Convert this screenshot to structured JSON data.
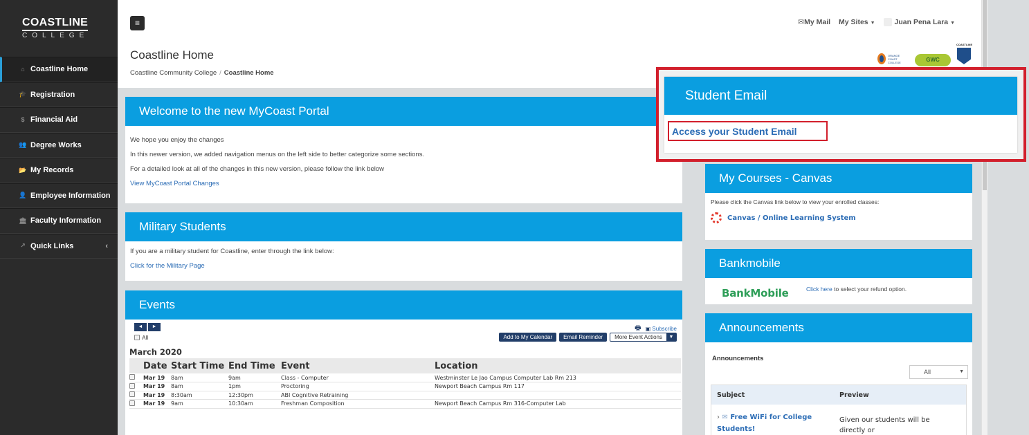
{
  "brand": {
    "line1": "COASTLINE",
    "line2": "COLLEGE"
  },
  "sidebar": {
    "items": [
      {
        "label": "Coastline Home",
        "icon": "home-icon",
        "glyph": "⌂",
        "active": true
      },
      {
        "label": "Registration",
        "icon": "graduation-cap-icon",
        "glyph": "🎓"
      },
      {
        "label": "Financial Aid",
        "icon": "money-icon",
        "glyph": "$"
      },
      {
        "label": "Degree Works",
        "icon": "users-icon",
        "glyph": "👥"
      },
      {
        "label": "My Records",
        "icon": "folder-icon",
        "glyph": "📂"
      },
      {
        "label": "Employee Information",
        "icon": "user-icon",
        "glyph": "👤"
      },
      {
        "label": "Faculty Information",
        "icon": "bank-icon",
        "glyph": "🏛"
      },
      {
        "label": "Quick Links",
        "icon": "external-link-icon",
        "glyph": "↗",
        "chevron": "‹"
      }
    ]
  },
  "header": {
    "menu_glyph": "≡",
    "title": "Coastline Home",
    "breadcrumb": {
      "root": "Coastline Community College",
      "sep": "/",
      "current": "Coastline Home"
    },
    "topnav": {
      "mail": "My Mail",
      "sites": "My Sites",
      "user": "Juan Pena Lara"
    },
    "logos": {
      "occ": "ORANGE COAST COLLEGE",
      "gwc": "GWC",
      "cc": "COASTLINE"
    }
  },
  "welcome": {
    "title": "Welcome to the new MyCoast Portal",
    "lines": [
      "We hope you enjoy the changes",
      "In this newer version, we added navigation menus on the left side to better categorize some sections.",
      "For a detailed look at all of the changes in this new version, please follow the link below"
    ],
    "link": "View MyCoast Portal Changes"
  },
  "military": {
    "title": "Military Students",
    "text": "If you are a military student for Coastline, enter through the link below:",
    "link": "Click for the Military Page"
  },
  "events": {
    "title": "Events",
    "prev": "◄",
    "next": "►",
    "subscribe": "Subscribe",
    "all": "All",
    "add_calendar": "Add to My Calendar",
    "email_reminder": "Email Reminder",
    "more_actions": "More Event Actions",
    "month": "March 2020",
    "columns": [
      "Date",
      "Start Time",
      "End Time",
      "Event",
      "Location"
    ],
    "rows": [
      {
        "date": "Mar 19",
        "start": "8am",
        "end": "9am",
        "event": "Class - Computer",
        "location": "Westminster Le Jao Campus Computer Lab Rm 213"
      },
      {
        "date": "Mar 19",
        "start": "8am",
        "end": "1pm",
        "event": "Proctoring",
        "location": "Newport Beach Campus Rm 117"
      },
      {
        "date": "Mar 19",
        "start": "8:30am",
        "end": "12:30pm",
        "event": "ABI Cognitive Retraining",
        "location": ""
      },
      {
        "date": "Mar 19",
        "start": "9am",
        "end": "10:30am",
        "event": "Freshman Composition",
        "location": "Newport Beach Campus Rm 316-Computer Lab"
      }
    ]
  },
  "student_email": {
    "title": "Student Email",
    "link": "Access your Student Email"
  },
  "canvas": {
    "title": "My Courses - Canvas",
    "text": "Please click the Canvas link below to view your enrolled classes:",
    "link": "Canvas / Online Learning System"
  },
  "bankmobile": {
    "title": "Bankmobile",
    "logo": "BankMobile",
    "link": "Click here",
    "text": " to select your refund option."
  },
  "announcements": {
    "title": "Announcements",
    "subtitle": "Announcements",
    "filter": "All",
    "col_subject": "Subject",
    "col_preview": "Preview",
    "row_subject": "Free WiFi for College Students!",
    "row_preview": "Given our students will be directly or"
  },
  "colors": {
    "accent": "#0a9ee0",
    "sidebar": "#2b2b2b",
    "highlight": "#d21f2c"
  }
}
